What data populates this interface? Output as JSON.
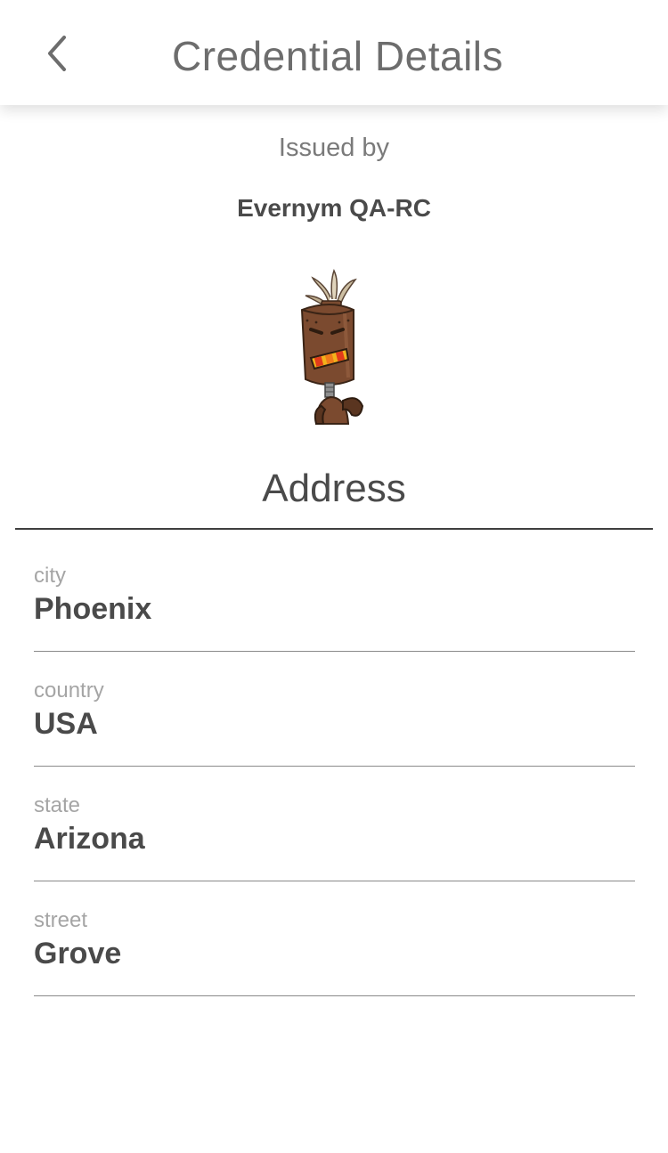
{
  "header": {
    "back_icon": "chevron-left-icon",
    "title": "Credential Details"
  },
  "issuer": {
    "label": "Issued by",
    "name": "Evernym QA-RC",
    "avatar": "robot-totem-avatar"
  },
  "credential": {
    "name": "Address",
    "attributes": [
      {
        "label": "city",
        "value": "Phoenix"
      },
      {
        "label": "country",
        "value": "USA"
      },
      {
        "label": "state",
        "value": "Arizona"
      },
      {
        "label": "street",
        "value": "Grove"
      }
    ]
  }
}
